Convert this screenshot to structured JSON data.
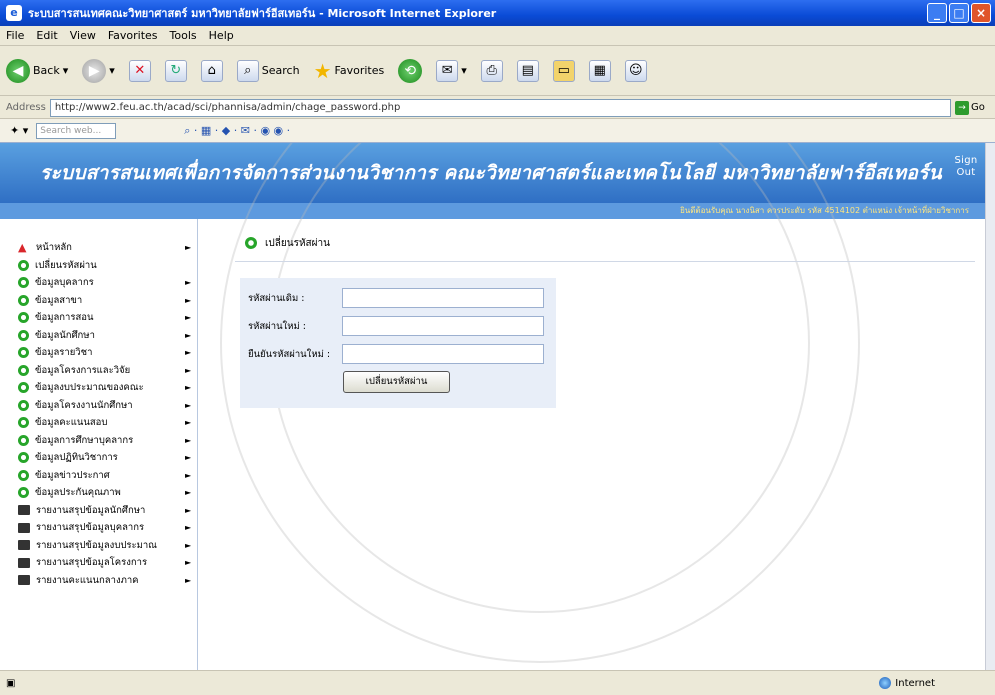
{
  "window": {
    "title": "ระบบสารสนเทศคณะวิทยาศาสตร์ มหาวิทยาลัยฟาร์อีสเทอร์น - Microsoft Internet Explorer"
  },
  "menu": [
    "File",
    "Edit",
    "View",
    "Favorites",
    "Tools",
    "Help"
  ],
  "toolbar": {
    "back": "Back",
    "search": "Search",
    "favorites": "Favorites"
  },
  "address": {
    "label": "Address",
    "url": "http://www2.feu.ac.th/acad/sci/phannisa/admin/chage_password.php",
    "go": "Go"
  },
  "searchbar": {
    "placeholder": "Search web..."
  },
  "banner": {
    "title": "ระบบสารสนเทศเพื่อการจัดการส่วนงานวิชาการ คณะวิทยาศาสตร์และเทคโนโลยี มหาวิทยาลัยฟาร์อีสเทอร์น",
    "signout": "Sign Out"
  },
  "userbar": {
    "text": "ยินดีต้อนรับคุณ นางนิสา ควรประดับ รหัส 4514102 ตำแหน่ง เจ้าหน้าที่ฝ่ายวิชาการ"
  },
  "sidebar": {
    "items": [
      {
        "label": "หน้าหลัก",
        "icon": "home-icon",
        "arrow": true
      },
      {
        "label": "เปลี่ยนรหัสผ่าน",
        "icon": "circle-icon",
        "arrow": false
      },
      {
        "label": "ข้อมูลบุคลากร",
        "icon": "circle-icon",
        "arrow": true
      },
      {
        "label": "ข้อมูลสาขา",
        "icon": "circle-icon",
        "arrow": true
      },
      {
        "label": "ข้อมูลการสอน",
        "icon": "circle-icon",
        "arrow": true
      },
      {
        "label": "ข้อมูลนักศึกษา",
        "icon": "circle-icon",
        "arrow": true
      },
      {
        "label": "ข้อมูลรายวิชา",
        "icon": "circle-icon",
        "arrow": true
      },
      {
        "label": "ข้อมูลโครงการและวิจัย",
        "icon": "circle-icon",
        "arrow": true
      },
      {
        "label": "ข้อมูลงบประมาณของคณะ",
        "icon": "circle-icon",
        "arrow": true
      },
      {
        "label": "ข้อมูลโครงงานนักศึกษา",
        "icon": "circle-icon",
        "arrow": true
      },
      {
        "label": "ข้อมูลคะแนนสอบ",
        "icon": "circle-icon",
        "arrow": true
      },
      {
        "label": "ข้อมูลการศึกษาบุคลากร",
        "icon": "circle-icon",
        "arrow": true
      },
      {
        "label": "ข้อมูลปฏิทินวิชาการ",
        "icon": "circle-icon",
        "arrow": true
      },
      {
        "label": "ข้อมูลข่าวประกาศ",
        "icon": "circle-icon",
        "arrow": true
      },
      {
        "label": "ข้อมูลประกันคุณภาพ",
        "icon": "circle-icon",
        "arrow": true
      },
      {
        "label": "รายงานสรุปข้อมูลนักศึกษา",
        "icon": "book-icon",
        "arrow": true
      },
      {
        "label": "รายงานสรุปข้อมูลบุคลากร",
        "icon": "book-icon",
        "arrow": true
      },
      {
        "label": "รายงานสรุปข้อมูลงบประมาณ",
        "icon": "book-icon",
        "arrow": true
      },
      {
        "label": "รายงานสรุปข้อมูลโครงการ",
        "icon": "book-icon",
        "arrow": true
      },
      {
        "label": "รายงานคะแนนกลางภาค",
        "icon": "book-icon",
        "arrow": true
      }
    ]
  },
  "page": {
    "title": "เปลี่ยนรหัสผ่าน",
    "fields": [
      {
        "label": "รหัสผ่านเดิม :",
        "value": ""
      },
      {
        "label": "รหัสผ่านใหม่ :",
        "value": ""
      },
      {
        "label": "ยืนยันรหัสผ่านใหม่ :",
        "value": ""
      }
    ],
    "submit": "เปลี่ยนรหัสผ่าน"
  },
  "status": {
    "zone": "Internet"
  }
}
